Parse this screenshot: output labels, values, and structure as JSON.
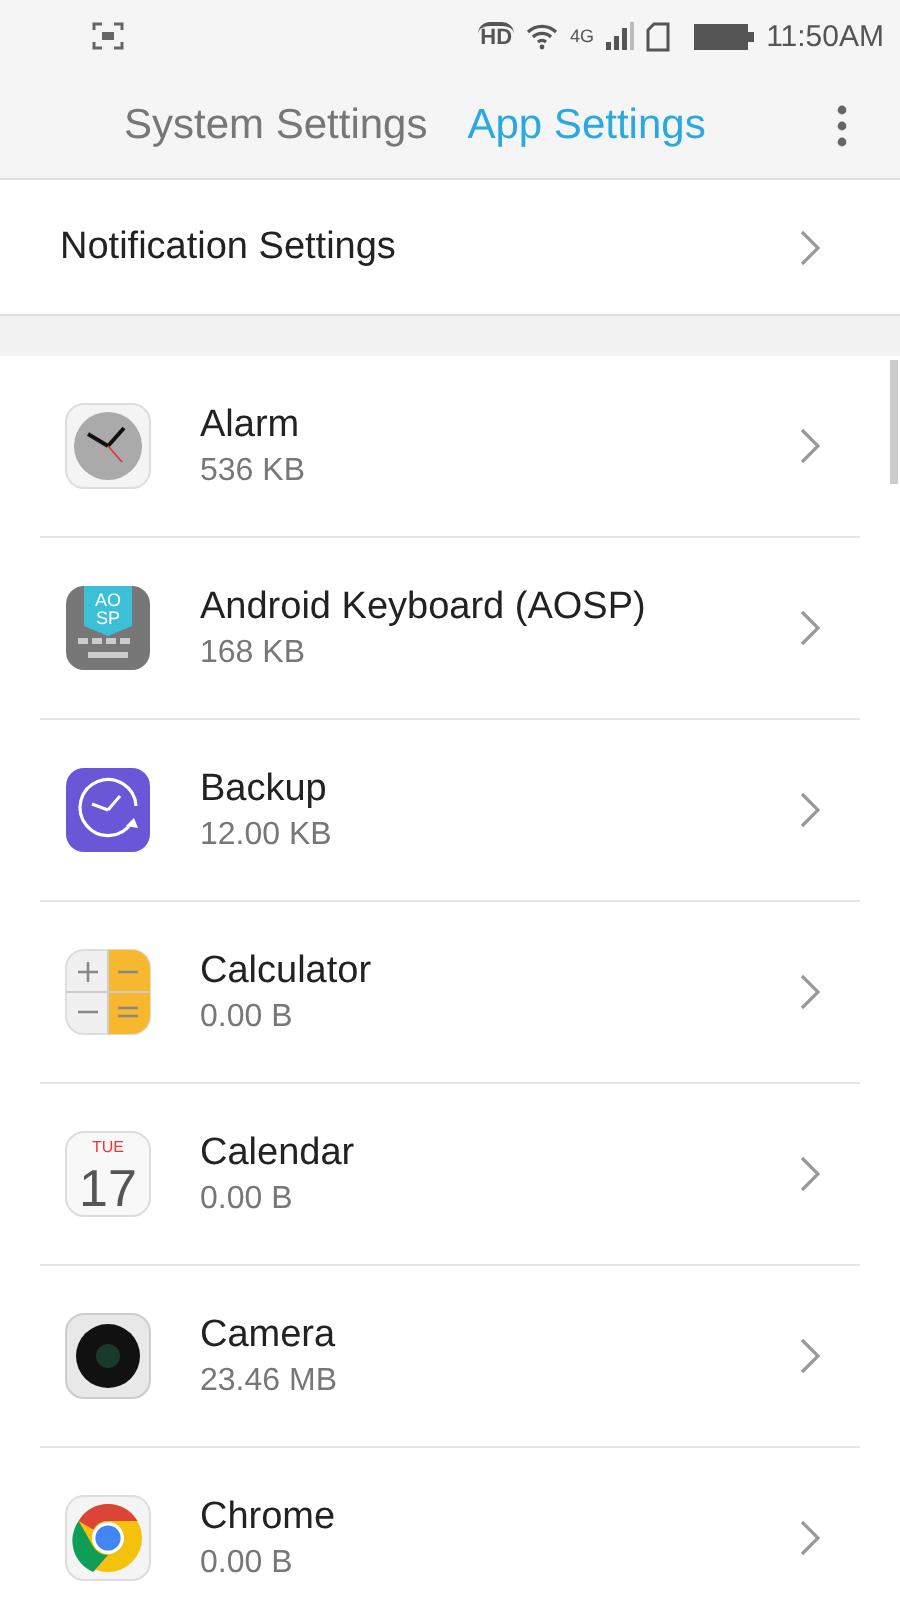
{
  "status_bar": {
    "hd": "HD",
    "network": "4G",
    "time": "11:50AM"
  },
  "tabs": [
    {
      "label": "System Settings",
      "selected": false
    },
    {
      "label": "App Settings",
      "selected": true
    }
  ],
  "notification_settings": {
    "label": "Notification Settings"
  },
  "apps": [
    {
      "name": "Alarm",
      "size": "536 KB",
      "kind": "clock"
    },
    {
      "name": "Android Keyboard (AOSP)",
      "size": "168 KB",
      "kind": "keyboard",
      "icon_text": "AO SP"
    },
    {
      "name": "Backup",
      "size": "12.00 KB",
      "kind": "backup"
    },
    {
      "name": "Calculator",
      "size": "0.00 B",
      "kind": "calculator"
    },
    {
      "name": "Calendar",
      "size": "0.00 B",
      "kind": "calendar",
      "icon_text": "TUE",
      "icon_number": "17"
    },
    {
      "name": "Camera",
      "size": "23.46 MB",
      "kind": "camera"
    },
    {
      "name": "Chrome",
      "size": "0.00 B",
      "kind": "chrome"
    }
  ]
}
